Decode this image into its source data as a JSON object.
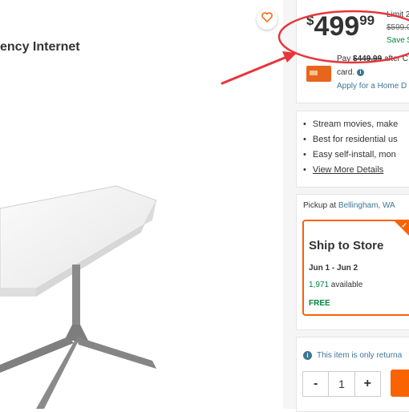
{
  "product": {
    "title": "ency Internet"
  },
  "price": {
    "dollar_sign": "$",
    "main": "499",
    "cents": "99",
    "limit": "Limit 2",
    "was": "$599.0",
    "save": "Save $"
  },
  "credit": {
    "pay_prefix": "Pay ",
    "pay_strike": "$449.99",
    "pay_suffix": " after C",
    "card_text": "card.",
    "info_glyph": "i",
    "apply": "Apply for a Home D"
  },
  "highlights": [
    "Stream movies, make",
    "Best for residential us",
    "Easy self-install, mon",
    "View More Details"
  ],
  "pickup": {
    "prefix": "Pickup at ",
    "store": "Bellingham, WA"
  },
  "ship_to_store": {
    "title": "Ship to Store",
    "dates": "Jun 1 - Jun 2",
    "available_count": "1,971",
    "available_label": " available",
    "cost": "FREE",
    "check_glyph": "✓"
  },
  "returns": {
    "text": "This item is only returna",
    "info_glyph": "i"
  },
  "quantity": {
    "minus": "-",
    "value": "1",
    "plus": "+"
  },
  "colors": {
    "accent": "#f96302",
    "annotation": "#e8343a",
    "link": "#3e7697",
    "success": "#00873c"
  },
  "icons": {
    "favorite": "heart-icon",
    "card": "credit-card-icon",
    "info": "info-icon",
    "check": "check-icon"
  }
}
